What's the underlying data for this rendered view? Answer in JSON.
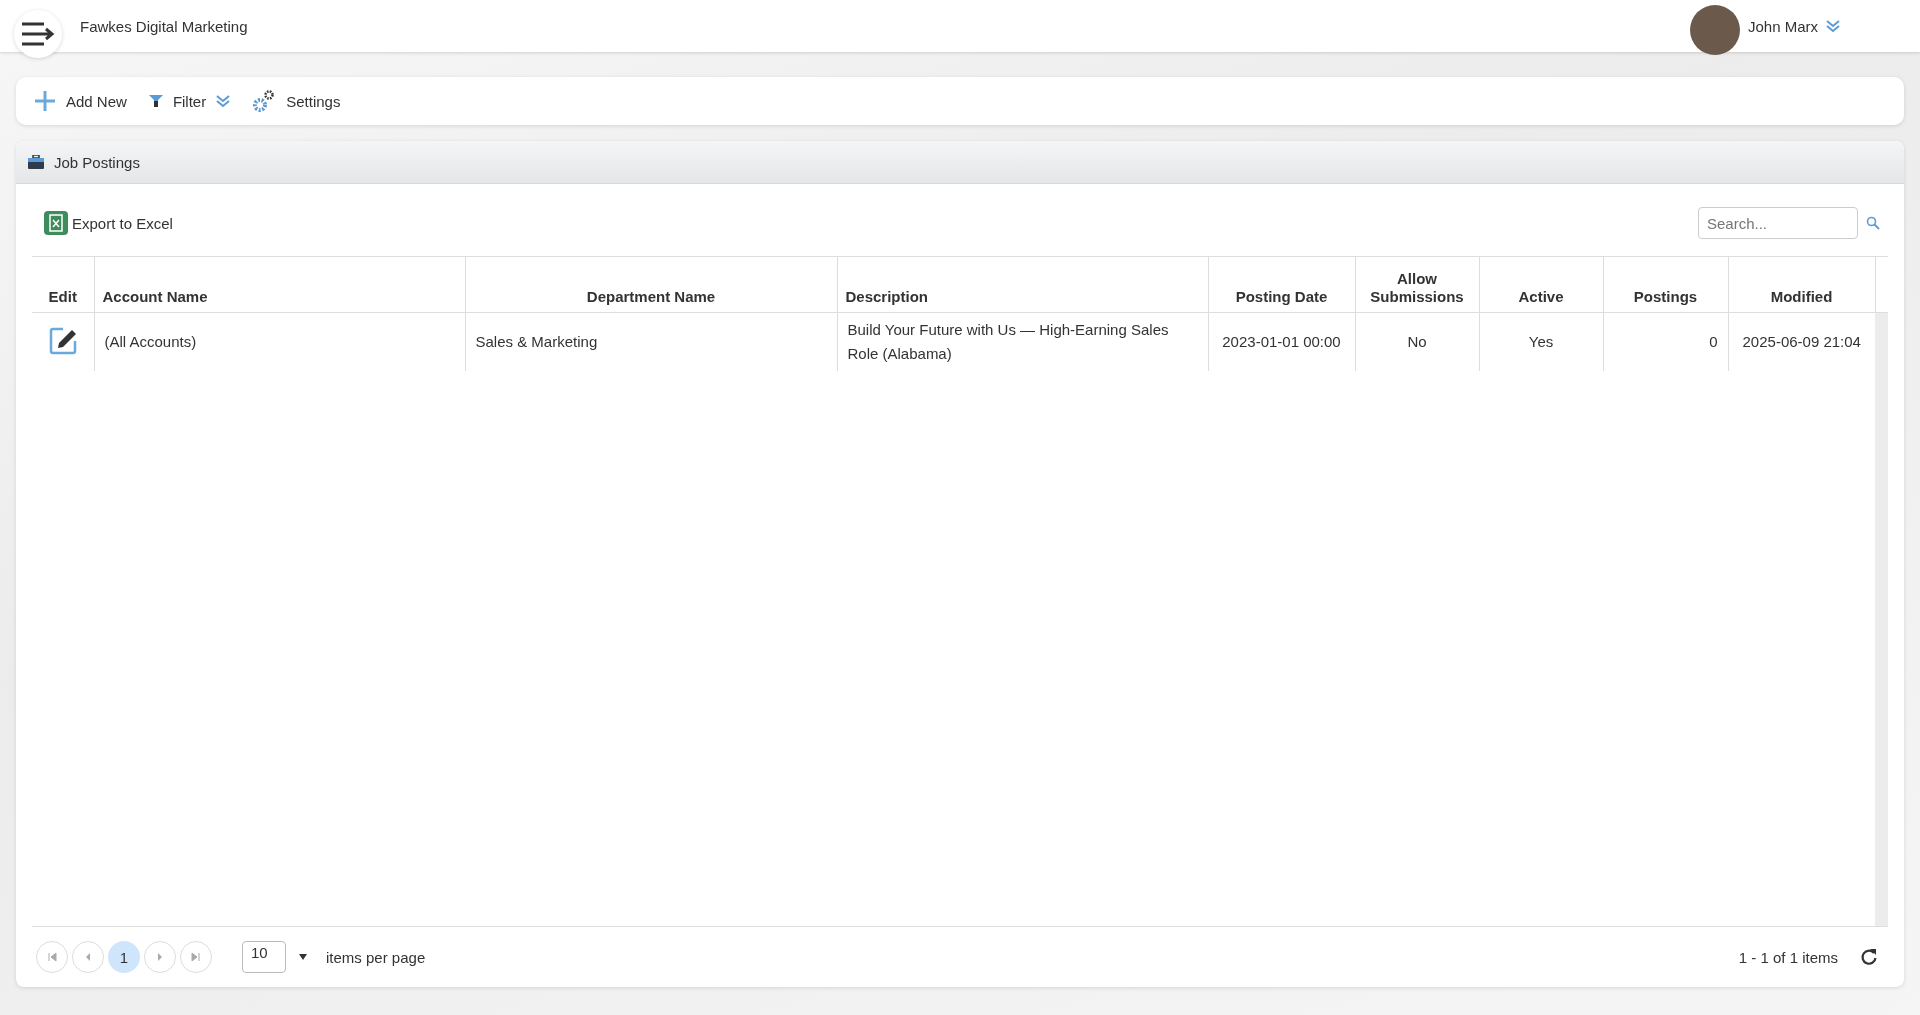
{
  "header": {
    "company": "Fawkes Digital Marketing",
    "user": "John Marx"
  },
  "toolbar": [
    {
      "kind": "add",
      "label": "Add New"
    },
    {
      "kind": "filter",
      "label": "Filter"
    },
    {
      "kind": "settings",
      "label": "Settings"
    }
  ],
  "panel": {
    "title": "Job Postings"
  },
  "grid": {
    "export_label": "Export to Excel",
    "search": {
      "placeholder": "Search..."
    },
    "columns": [
      "Edit",
      "Account Name",
      "Department Name",
      "Description",
      "Posting Date",
      "Allow Submissions",
      "Active",
      "Postings",
      "Modified"
    ],
    "rows": [
      {
        "cells": [
          "",
          "(All Accounts)",
          "Sales & Marketing",
          "Build Your Future with Us — High-Earning Sales Role (Alabama)",
          "2023-01-01 00:00",
          "No",
          "Yes",
          "0",
          "2025-06-09 21:04"
        ]
      }
    ]
  },
  "pager": {
    "pages": [
      {
        "label": "1",
        "selected": true
      }
    ],
    "page_size": "10",
    "page_size_label": "items per page",
    "summary": "1 - 1 of 1 items"
  }
}
